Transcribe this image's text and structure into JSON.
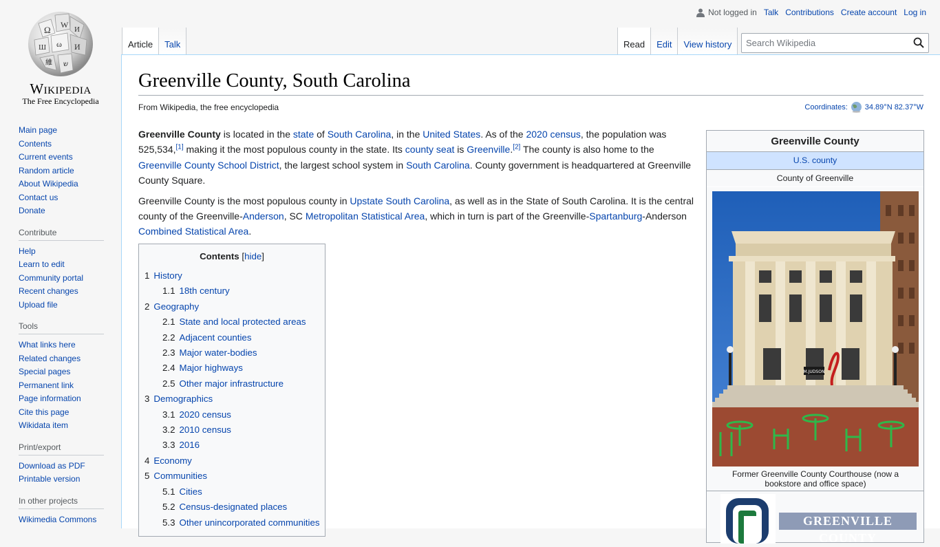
{
  "logo": {
    "wordmark": "Wikipedia",
    "tagline": "The Free Encyclopedia",
    "icon": "wikipedia-globe-icon"
  },
  "sidebar": {
    "navigation": [
      "Main page",
      "Contents",
      "Current events",
      "Random article",
      "About Wikipedia",
      "Contact us",
      "Donate"
    ],
    "contribute": {
      "heading": "Contribute",
      "items": [
        "Help",
        "Learn to edit",
        "Community portal",
        "Recent changes",
        "Upload file"
      ]
    },
    "tools": {
      "heading": "Tools",
      "items": [
        "What links here",
        "Related changes",
        "Special pages",
        "Permanent link",
        "Page information",
        "Cite this page",
        "Wikidata item"
      ]
    },
    "print": {
      "heading": "Print/export",
      "items": [
        "Download as PDF",
        "Printable version"
      ]
    },
    "projects": {
      "heading": "In other projects",
      "items": [
        "Wikimedia Commons"
      ]
    }
  },
  "personal": {
    "not_logged": "Not logged in",
    "talk": "Talk",
    "contributions": "Contributions",
    "create_account": "Create account",
    "login": "Log in"
  },
  "tabs": {
    "article": "Article",
    "talk": "Talk",
    "read": "Read",
    "edit": "Edit",
    "history": "View history"
  },
  "search": {
    "placeholder": "Search Wikipedia"
  },
  "page": {
    "title": "Greenville County, South Carolina",
    "tagline": "From Wikipedia, the free encyclopedia",
    "coords_label": "Coordinates:",
    "coords_value": "34.89°N 82.37°W"
  },
  "paragraphs": {
    "p1": {
      "bold": "Greenville County",
      "t1": " is located in the ",
      "l_state": "state",
      "t2": " of ",
      "l_sc": "South Carolina",
      "t3": ", in the ",
      "l_us": "United States",
      "t4": ". As of the ",
      "l_census": "2020 census",
      "t5": ", the population was 525,534,",
      "ref1": "[1]",
      "t6": " making it the most populous county in the state. Its ",
      "l_seat": "county seat",
      "t7": " is ",
      "l_gville": "Greenville",
      "t8": ".",
      "ref2": "[2]",
      "t9": " The county is also home to the ",
      "l_school": "Greenville County School District",
      "t10": ", the largest school system in ",
      "l_sc2": "South Carolina",
      "t11": ". County government is headquartered at Greenville County Square."
    },
    "p2": {
      "t1": "Greenville County is the most populous county in ",
      "l_upstate": "Upstate South Carolina",
      "t2": ", as well as in the State of South Carolina. It is the central county of the Greenville-",
      "l_anderson": "Anderson",
      "t3": ", SC ",
      "l_msa": "Metropolitan Statistical Area",
      "t4": ", which in turn is part of the Greenville-",
      "l_spartanburg": "Spartanburg",
      "t5": "-Anderson ",
      "l_csa": "Combined Statistical Area",
      "t6": "."
    }
  },
  "toc": {
    "title": "Contents",
    "hide": "hide",
    "items": [
      {
        "num": "1",
        "label": "History",
        "sub": false
      },
      {
        "num": "1.1",
        "label": "18th century",
        "sub": true
      },
      {
        "num": "2",
        "label": "Geography",
        "sub": false
      },
      {
        "num": "2.1",
        "label": "State and local protected areas",
        "sub": true
      },
      {
        "num": "2.2",
        "label": "Adjacent counties",
        "sub": true
      },
      {
        "num": "2.3",
        "label": "Major water-bodies",
        "sub": true
      },
      {
        "num": "2.4",
        "label": "Major highways",
        "sub": true
      },
      {
        "num": "2.5",
        "label": "Other major infrastructure",
        "sub": true
      },
      {
        "num": "3",
        "label": "Demographics",
        "sub": false
      },
      {
        "num": "3.1",
        "label": "2020 census",
        "sub": true
      },
      {
        "num": "3.2",
        "label": "2010 census",
        "sub": true
      },
      {
        "num": "3.3",
        "label": "2016",
        "sub": true
      },
      {
        "num": "4",
        "label": "Economy",
        "sub": false
      },
      {
        "num": "5",
        "label": "Communities",
        "sub": false
      },
      {
        "num": "5.1",
        "label": "Cities",
        "sub": true
      },
      {
        "num": "5.2",
        "label": "Census-designated places",
        "sub": true
      },
      {
        "num": "5.3",
        "label": "Other unincorporated communities",
        "sub": true
      }
    ]
  },
  "infobox": {
    "title": "Greenville County",
    "type": "U.S. county",
    "name": "County of Greenville",
    "caption": "Former Greenville County Courthouse (now a bookstore and office space)",
    "sign_text": "M.JUDSON",
    "logo_text": "GREENVILLE COUNTY"
  },
  "colors": {
    "link": "#0645ad",
    "border": "#a2a9b1",
    "infobox_type_bg": "#cfe3ff"
  }
}
